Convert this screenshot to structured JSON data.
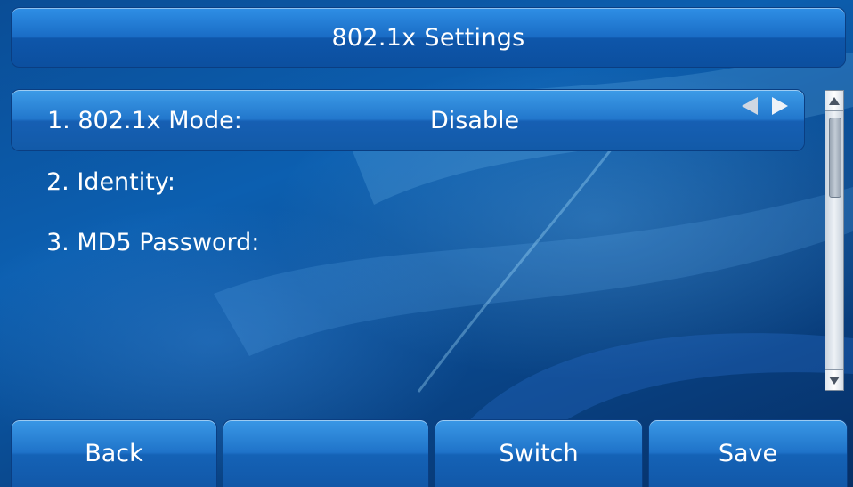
{
  "header": {
    "title": "802.1x Settings"
  },
  "settings": [
    {
      "label": "1. 802.1x Mode:",
      "value": "Disable",
      "selected": true
    },
    {
      "label": "2. Identity:",
      "value": "",
      "selected": false
    },
    {
      "label": "3. MD5 Password:",
      "value": "",
      "selected": false
    }
  ],
  "softkeys": [
    "Back",
    "",
    "Switch",
    "Save"
  ],
  "icons": {
    "value_left": "arrow-left-icon",
    "value_right": "arrow-right-icon",
    "scroll_up": "scroll-up-icon",
    "scroll_down": "scroll-down-icon"
  },
  "colors": {
    "background": "#0c5fb0",
    "bar": "#1a6dc6",
    "text": "#ffffff"
  }
}
